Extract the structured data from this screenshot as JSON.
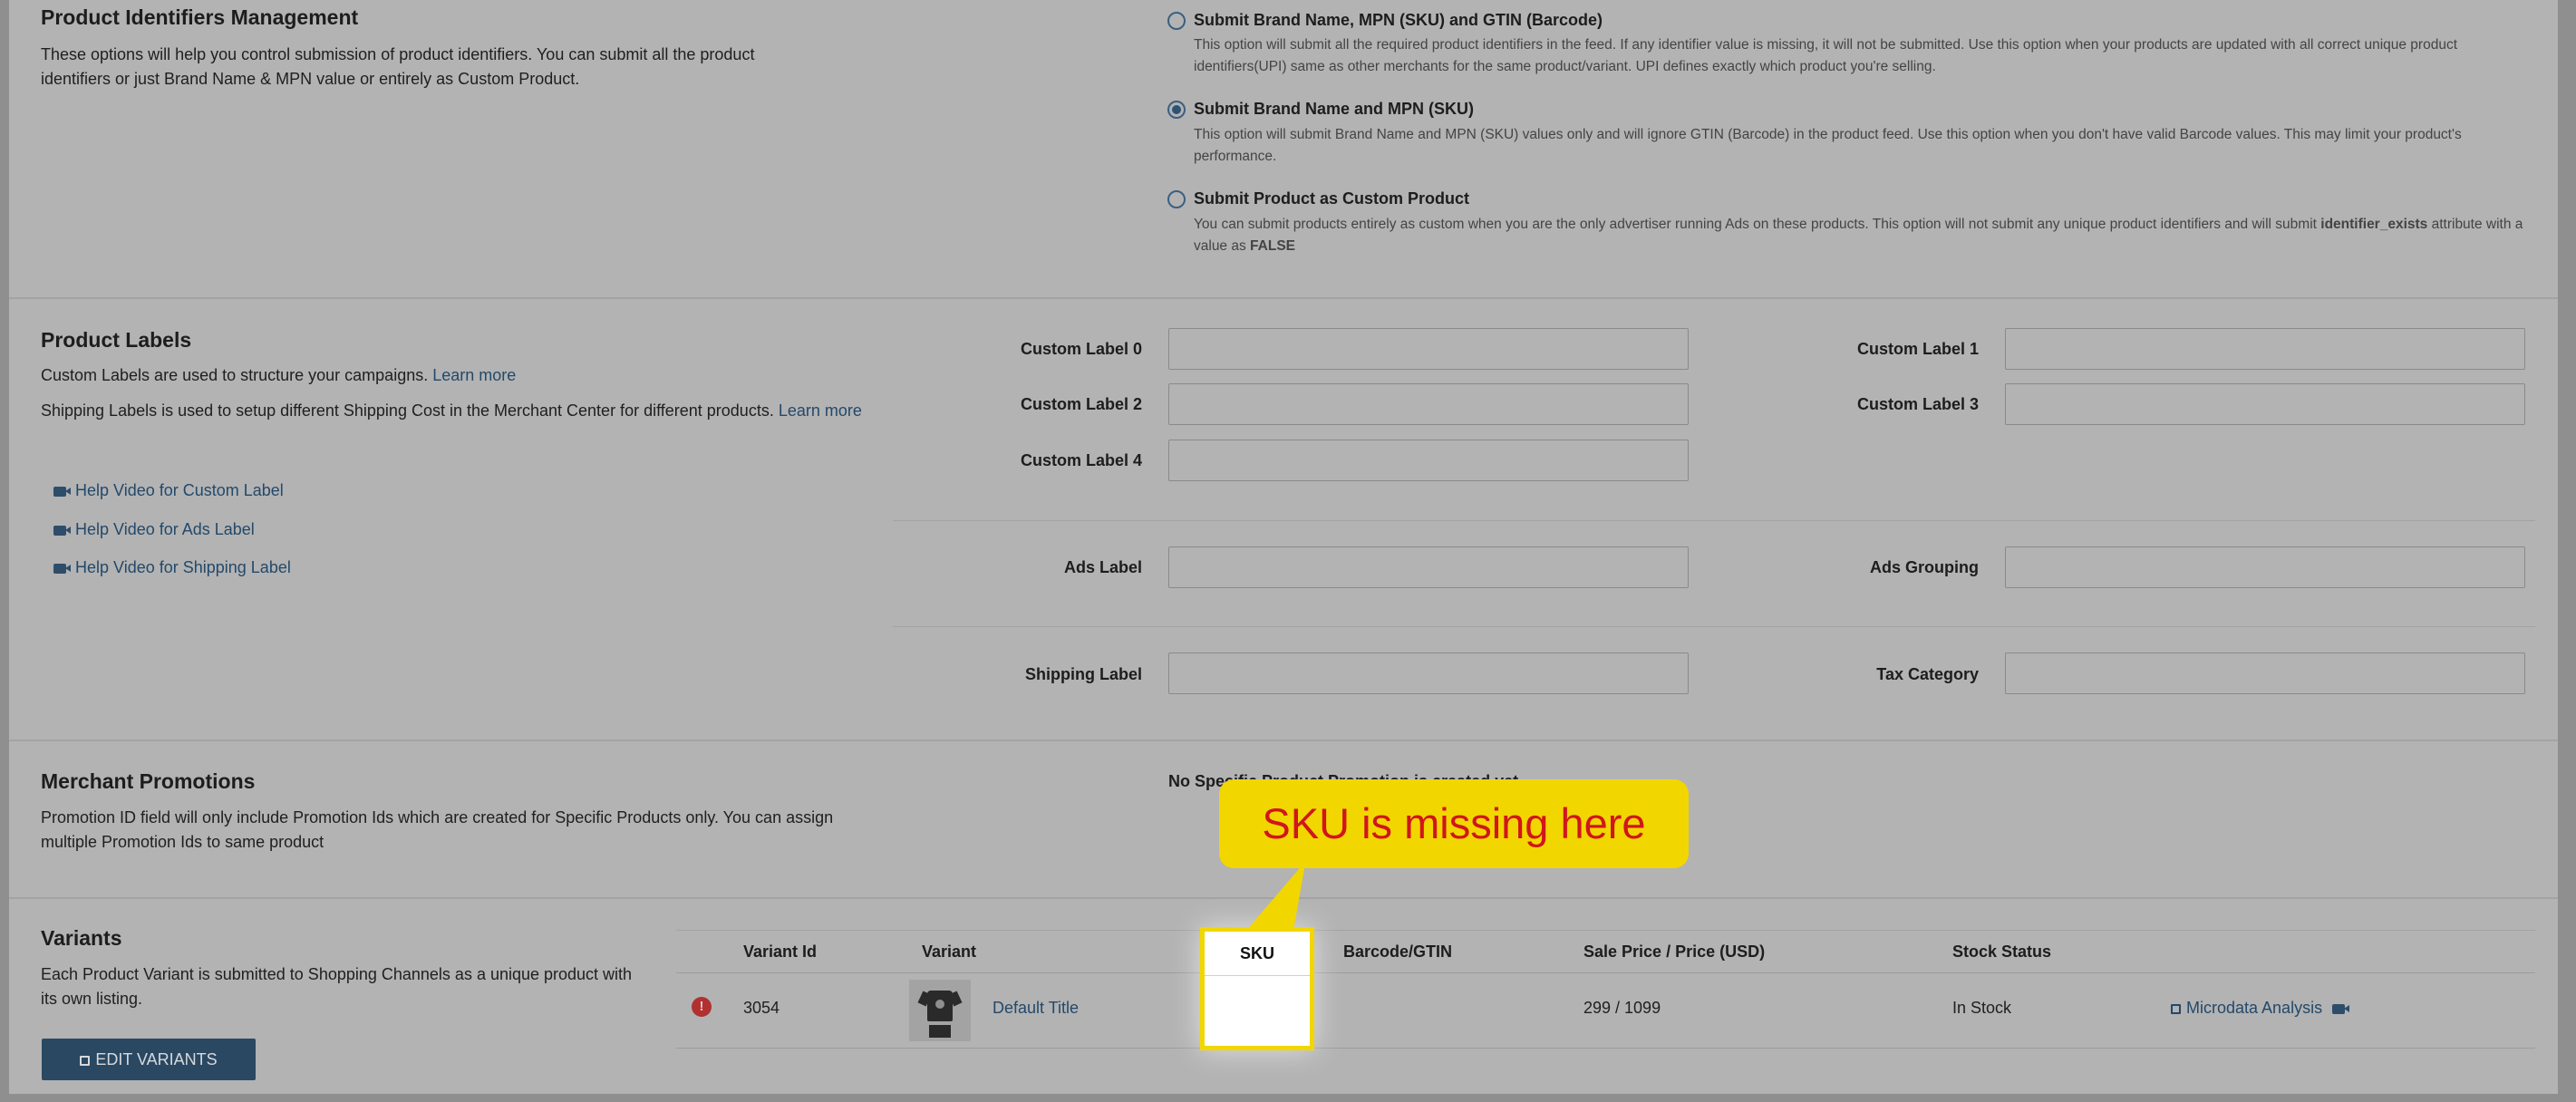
{
  "identifiers": {
    "title": "Product Identifiers Management",
    "description": "These options will help you control submission of product identifiers. You can submit all the product identifiers or just Brand Name & MPN value or entirely as Custom Product.",
    "options": [
      {
        "title": "Submit Brand Name, MPN (SKU) and GTIN (Barcode)",
        "desc": "This option will submit all the required product identifiers in the feed. If any identifier value is missing, it will not be submitted. Use this option when your products are updated with all correct unique product identifiers(UPI) same as other merchants for the same product/variant. UPI defines exactly which product you're selling.",
        "selected": false
      },
      {
        "title": "Submit Brand Name and MPN (SKU)",
        "desc": "This option will submit Brand Name and MPN (SKU) values only and will ignore GTIN (Barcode) in the product feed. Use this option when you don't have valid Barcode values. This may limit your product's performance.",
        "selected": true
      },
      {
        "title": "Submit Product as Custom Product",
        "desc_before": "You can submit products entirely as custom when you are the only advertiser running Ads on these products. This option will not submit any unique product identifiers and will submit ",
        "desc_bold1": "identifier_exists",
        "desc_mid": " attribute with a value as ",
        "desc_bold2": "FALSE",
        "selected": false
      }
    ]
  },
  "labels": {
    "title": "Product Labels",
    "desc1": "Custom Labels are used to structure your campaigns.",
    "desc1_link": "Learn more",
    "desc2": "Shipping Labels is used to setup different Shipping Cost in the Merchant Center for different products.",
    "desc2_link": "Learn more",
    "help_videos": [
      "Help Video for Custom Label",
      "Help Video for Ads Label",
      "Help Video for Shipping Label"
    ],
    "fields": {
      "custom_label_0": "Custom Label 0",
      "custom_label_1": "Custom Label 1",
      "custom_label_2": "Custom Label 2",
      "custom_label_3": "Custom Label 3",
      "custom_label_4": "Custom Label 4",
      "ads_label": "Ads Label",
      "ads_grouping": "Ads Grouping",
      "shipping_label": "Shipping Label",
      "tax_category": "Tax Category"
    }
  },
  "promotions": {
    "title": "Merchant Promotions",
    "description": "Promotion ID field will only include Promotion Ids which are created for Specific Products only. You can assign multiple Promotion Ids to same product",
    "status_visible": "No Specific Product Promotion is created yet."
  },
  "variants": {
    "title": "Variants",
    "description": "Each Product Variant is submitted to Shopping Channels as a unique product with its own listing.",
    "edit_button": "EDIT VARIANTS",
    "columns": [
      "Variant Id",
      "Variant",
      "SKU",
      "Barcode/GTIN",
      "Sale Price / Price (USD)",
      "Stock Status"
    ],
    "rows": [
      {
        "variant_id": "3054",
        "variant": "Default Title",
        "sku": "",
        "barcode": "",
        "price": "299 / 1099",
        "stock": "In Stock",
        "action": "Microdata Analysis"
      }
    ]
  },
  "callout": {
    "text": "SKU is missing here"
  },
  "colors": {
    "highlight": "#f2d600",
    "callout_text": "#d0161c",
    "link": "#23496a",
    "error": "#b0312f"
  }
}
